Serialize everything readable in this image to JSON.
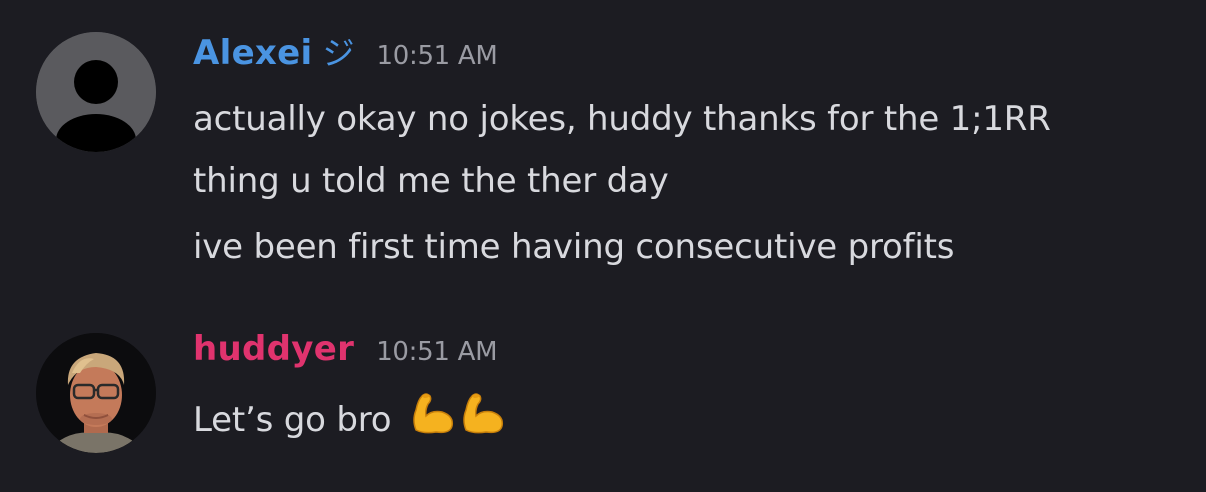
{
  "messages": [
    {
      "author": "Alexei",
      "name_suffix": "ジ",
      "time": "10:51 AM",
      "author_color": "#4a94e2",
      "avatar": "default-user-avatar",
      "lines": [
        "actually okay no jokes, huddy thanks for the 1;1RR",
        "thing u told me the ther day",
        "ive been first time having consecutive profits"
      ]
    },
    {
      "author": "huddyer",
      "time": "10:51 AM",
      "author_color": "#e0336e",
      "avatar": "user-photo-avatar",
      "text": "Let’s go bro",
      "emoji": [
        "flexed-biceps",
        "flexed-biceps"
      ]
    }
  ],
  "colors": {
    "background": "#1c1c22",
    "text": "#d8d9de",
    "timestamp": "#9a9ba3"
  }
}
